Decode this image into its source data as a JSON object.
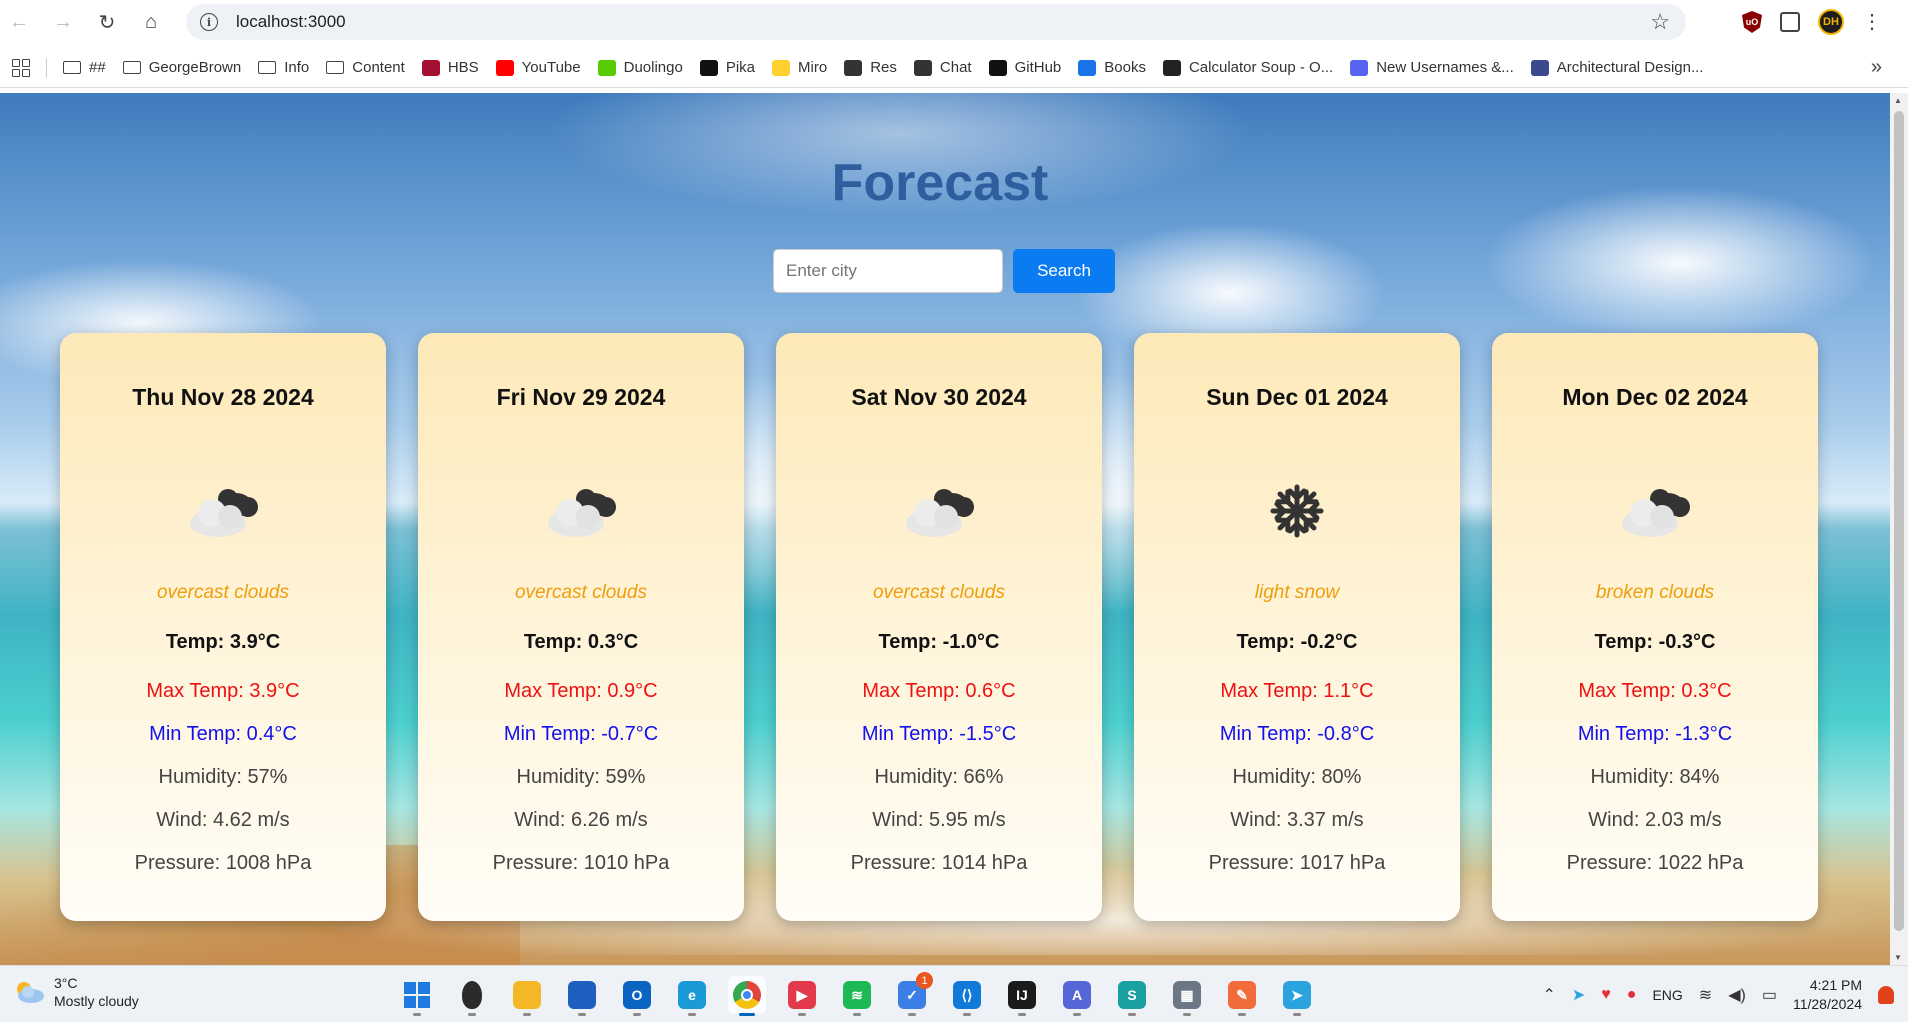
{
  "browser": {
    "url": "localhost:3000",
    "bookmarks": [
      {
        "label": "##",
        "icon": "folder-icon"
      },
      {
        "label": "GeorgeBrown",
        "icon": "folder-icon"
      },
      {
        "label": "Info",
        "icon": "folder-icon"
      },
      {
        "label": "Content",
        "icon": "folder-icon"
      },
      {
        "label": "HBS",
        "icon": "hbs-icon"
      },
      {
        "label": "YouTube",
        "icon": "youtube-icon"
      },
      {
        "label": "Duolingo",
        "icon": "duolingo-icon"
      },
      {
        "label": "Pika",
        "icon": "pika-icon"
      },
      {
        "label": "Miro",
        "icon": "miro-icon"
      },
      {
        "label": "Res",
        "icon": "globe-icon"
      },
      {
        "label": "Chat",
        "icon": "chatgpt-icon"
      },
      {
        "label": "GitHub",
        "icon": "github-icon"
      },
      {
        "label": "Books",
        "icon": "books-icon"
      },
      {
        "label": "Calculator Soup - O...",
        "icon": "sigma-icon"
      },
      {
        "label": "New Usernames &...",
        "icon": "discord-icon"
      },
      {
        "label": "Architectural Design...",
        "icon": "arch-icon"
      }
    ],
    "profile_initials": "DH"
  },
  "page": {
    "title": "Forecast",
    "search": {
      "placeholder": "Enter city",
      "value": "",
      "button": "Search"
    },
    "cards": [
      {
        "date": "Thu Nov 28 2024",
        "icon": "cloud-icon",
        "desc": "overcast clouds",
        "temp": "Temp: 3.9°C",
        "max": "Max Temp: 3.9°C",
        "min": "Min Temp: 0.4°C",
        "humidity": "Humidity: 57%",
        "wind": "Wind: 4.62 m/s",
        "pressure": "Pressure: 1008 hPa"
      },
      {
        "date": "Fri Nov 29 2024",
        "icon": "cloud-icon",
        "desc": "overcast clouds",
        "temp": "Temp: 0.3°C",
        "max": "Max Temp: 0.9°C",
        "min": "Min Temp: -0.7°C",
        "humidity": "Humidity: 59%",
        "wind": "Wind: 6.26 m/s",
        "pressure": "Pressure: 1010 hPa"
      },
      {
        "date": "Sat Nov 30 2024",
        "icon": "cloud-icon",
        "desc": "overcast clouds",
        "temp": "Temp: -1.0°C",
        "max": "Max Temp: 0.6°C",
        "min": "Min Temp: -1.5°C",
        "humidity": "Humidity: 66%",
        "wind": "Wind: 5.95 m/s",
        "pressure": "Pressure: 1014 hPa"
      },
      {
        "date": "Sun Dec 01 2024",
        "icon": "snowflake-icon",
        "desc": "light snow",
        "temp": "Temp: -0.2°C",
        "max": "Max Temp: 1.1°C",
        "min": "Min Temp: -0.8°C",
        "humidity": "Humidity: 80%",
        "wind": "Wind: 3.37 m/s",
        "pressure": "Pressure: 1017 hPa"
      },
      {
        "date": "Mon Dec 02 2024",
        "icon": "cloud-icon",
        "desc": "broken clouds",
        "temp": "Temp: -0.3°C",
        "max": "Max Temp: 0.3°C",
        "min": "Min Temp: -1.3°C",
        "humidity": "Humidity: 84%",
        "wind": "Wind: 2.03 m/s",
        "pressure": "Pressure: 1022 hPa"
      }
    ]
  },
  "taskbar": {
    "weather_temp": "3°C",
    "weather_desc": "Mostly cloudy",
    "apps": [
      {
        "name": "start-icon",
        "color": "#1f7ae0",
        "glyph": "",
        "active": false
      },
      {
        "name": "alien-icon",
        "color": "#2b2b2b",
        "glyph": "",
        "active": false
      },
      {
        "name": "file-explorer-icon",
        "color": "#f4b826",
        "glyph": "",
        "active": false
      },
      {
        "name": "store-icon",
        "color": "#1f5fbf",
        "glyph": "",
        "active": false
      },
      {
        "name": "outlook-icon",
        "color": "#0a64c2",
        "glyph": "O",
        "active": false
      },
      {
        "name": "edge-icon",
        "color": "#1a9bd7",
        "glyph": "e",
        "active": false
      },
      {
        "name": "chrome-icon",
        "color": "#e2453c",
        "glyph": "",
        "active": true
      },
      {
        "name": "media-player-icon",
        "color": "#e33a4b",
        "glyph": "▶",
        "active": false
      },
      {
        "name": "spotify-icon",
        "color": "#1db954",
        "glyph": "≋",
        "active": false
      },
      {
        "name": "todo-icon",
        "color": "#3a7ee6",
        "glyph": "✓",
        "active": false,
        "badge": "1"
      },
      {
        "name": "vscode-icon",
        "color": "#0f7ad8",
        "glyph": "⟨⟩",
        "active": false
      },
      {
        "name": "intellij-icon",
        "color": "#1a1a1a",
        "glyph": "IJ",
        "active": false
      },
      {
        "name": "font-app-icon",
        "color": "#5566d8",
        "glyph": "A",
        "active": false
      },
      {
        "name": "sourcetree-icon",
        "color": "#1aa0a0",
        "glyph": "S",
        "active": false
      },
      {
        "name": "calculator-icon",
        "color": "#6b7785",
        "glyph": "▦",
        "active": false
      },
      {
        "name": "postman-icon",
        "color": "#f26b3a",
        "glyph": "✎",
        "active": false
      },
      {
        "name": "telegram-icon",
        "color": "#2aa3df",
        "glyph": "➤",
        "active": false
      }
    ],
    "lang": "ENG",
    "time": "4:21 PM",
    "date": "11/28/2024"
  }
}
